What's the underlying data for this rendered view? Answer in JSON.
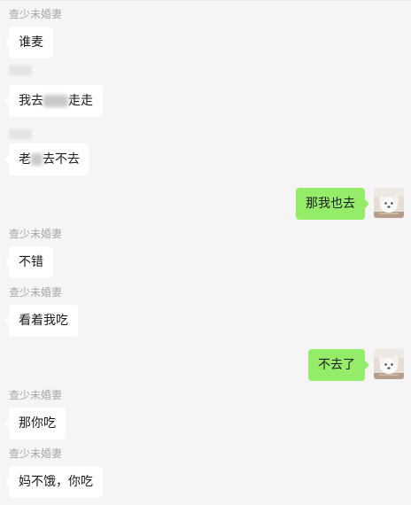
{
  "contact": {
    "name": "查少未婚妻"
  },
  "messages": [
    {
      "text": "谁麦"
    },
    {
      "before": "我去",
      "after": "走走"
    },
    {
      "before": "老",
      "after": "去不去"
    },
    {
      "text": "那我也去"
    },
    {
      "text": "不错"
    },
    {
      "text": "看着我吃"
    },
    {
      "text": "不去了"
    },
    {
      "text": "那你吃"
    },
    {
      "text": "妈不饿，你吃"
    }
  ],
  "colors": {
    "background": "#f5f5f5",
    "incoming_bubble": "#ffffff",
    "outgoing_bubble": "#95ec69",
    "sender_name": "#a8a8a8"
  },
  "icons": {
    "avatar": "white-dog-avatar-icon"
  }
}
